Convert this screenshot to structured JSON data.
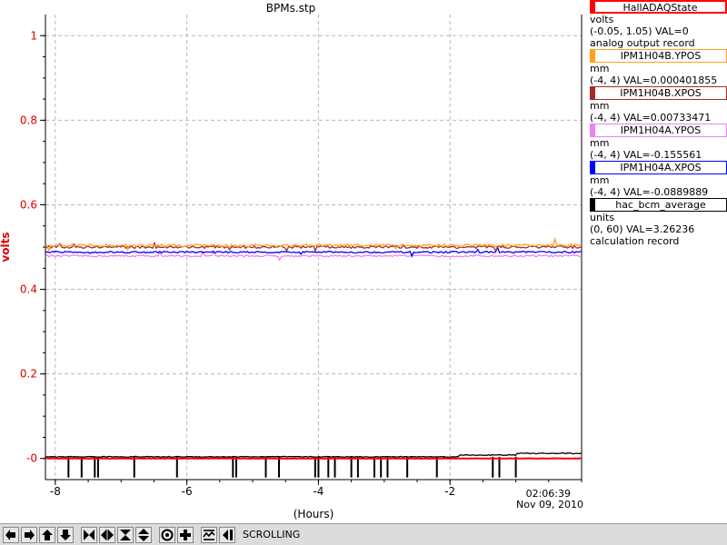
{
  "window": {
    "title": "BPMs.stp"
  },
  "chart_data": {
    "type": "line",
    "title": "BPMs.stp",
    "xlabel": "(Hours)",
    "ylabel": "volts",
    "xlim": [
      -8.15,
      0
    ],
    "ylim": [
      -0.05,
      1.05
    ],
    "x_ticks": [
      -8,
      -6,
      -4,
      -2
    ],
    "x_tick_labels": [
      "-8",
      "-6",
      "-4",
      "-2"
    ],
    "y_ticks": [
      0,
      0.2,
      0.4,
      0.6,
      0.8,
      1
    ],
    "y_tick_labels": [
      "-0",
      "0.2",
      "0.4",
      "0.6",
      "0.8",
      "1"
    ],
    "y_axis_color": "#dd0000",
    "end_time": "02:06:39",
    "end_date": "Nov 09, 2010",
    "grid": true,
    "legend_position": "right",
    "series": [
      {
        "name": "HallADAQState",
        "color": "#ff0000",
        "level": 0.0,
        "noise": 0.0005,
        "units": "volts",
        "range": "(-0.05, 1.05) VAL=0",
        "record": "analog output record"
      },
      {
        "name": "IPM1H04B.YPOS",
        "color": "#ffa020",
        "level": 0.504,
        "noise": 0.003,
        "units": "mm",
        "range": "(-4, 4) VAL=0.000401855",
        "record": ""
      },
      {
        "name": "IPM1H04B.XPOS",
        "color": "#a52a2a",
        "level": 0.5,
        "noise": 0.003,
        "units": "mm",
        "range": "(-4, 4) VAL=0.00733471",
        "record": ""
      },
      {
        "name": "IPM1H04A.YPOS",
        "color": "#ee82ee",
        "level": 0.479,
        "noise": 0.002,
        "units": "mm",
        "range": "(-4, 4) VAL=-0.155561",
        "record": ""
      },
      {
        "name": "IPM1H04A.XPOS",
        "color": "#0000ff",
        "level": 0.488,
        "noise": 0.002,
        "units": "mm",
        "range": "(-4, 4) VAL=-0.0889889",
        "record": ""
      },
      {
        "name": "hac_bcm_average",
        "color": "#000000",
        "level": 0.004,
        "noise": 0.002,
        "units": "units",
        "range": "(0, 60) VAL=3.26236",
        "record": "calculation record"
      }
    ],
    "bcm_step_points": [
      [
        -8.15,
        0.004
      ],
      [
        -2.1,
        0.004
      ],
      [
        -1.85,
        0.008
      ],
      [
        -1.0,
        0.012
      ],
      [
        0,
        0.013
      ]
    ],
    "bcm_dropouts": [
      -7.8,
      -7.6,
      -7.4,
      -7.35,
      -6.8,
      -6.15,
      -5.3,
      -5.25,
      -4.8,
      -4.6,
      -4.05,
      -4.0,
      -3.85,
      -3.75,
      -3.5,
      -3.4,
      -3.15,
      -3.05,
      -2.95,
      -2.65,
      -2.2,
      -1.35,
      -1.25,
      -1.0
    ]
  },
  "toolbar": {
    "buttons": [
      {
        "name": "scroll-left-button",
        "icon": "arrow-left-icon"
      },
      {
        "name": "scroll-right-button",
        "icon": "arrow-right-icon"
      },
      {
        "name": "scroll-up-button",
        "icon": "arrow-up-icon"
      },
      {
        "name": "scroll-down-button",
        "icon": "arrow-down-icon"
      },
      {
        "name": "zoom-in-x-button",
        "icon": "zoom-in-x-icon"
      },
      {
        "name": "zoom-out-x-button",
        "icon": "zoom-out-x-icon"
      },
      {
        "name": "zoom-in-y-button",
        "icon": "zoom-in-y-icon"
      },
      {
        "name": "zoom-out-y-button",
        "icon": "zoom-out-y-icon"
      },
      {
        "name": "auto-scale-button",
        "icon": "target-icon"
      },
      {
        "name": "add-pv-button",
        "icon": "plus-icon"
      },
      {
        "name": "scrolling-mode-button",
        "icon": "scroll-mode-icon"
      },
      {
        "name": "back-to-live-button",
        "icon": "back-to-live-icon"
      }
    ],
    "status": "SCROLLING"
  }
}
